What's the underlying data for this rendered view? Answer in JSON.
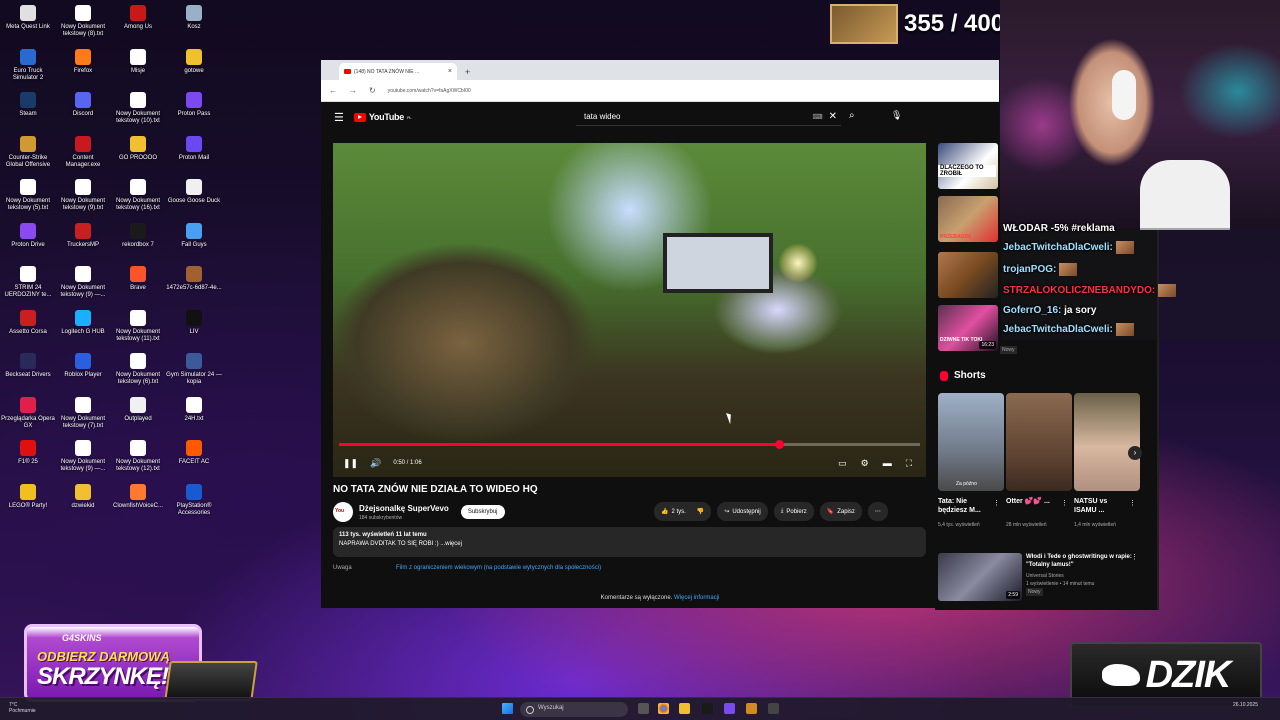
{
  "desktop_icons": [
    {
      "label": "Meta Quest Link",
      "color": "#e0e0e0"
    },
    {
      "label": "Nowy Dokument tekstowy (8).txt",
      "color": "#ffffff"
    },
    {
      "label": "Among Us",
      "color": "#c81818"
    },
    {
      "label": "Kosz",
      "color": "#9ab0c8"
    },
    {
      "label": "Euro Truck Simulator 2",
      "color": "#2a6ad0"
    },
    {
      "label": "Firefox",
      "color": "#ff7a18"
    },
    {
      "label": "Misje",
      "color": "#ffffff"
    },
    {
      "label": "gotowe",
      "color": "#f0c030"
    },
    {
      "label": "Steam",
      "color": "#1a3a6a"
    },
    {
      "label": "Discord",
      "color": "#5865f2"
    },
    {
      "label": "Nowy Dokument tekstowy (10).txt",
      "color": "#ffffff"
    },
    {
      "label": "Proton Pass",
      "color": "#7a4af0"
    },
    {
      "label": "Counter-Strike Global Offensive",
      "color": "#d09a30"
    },
    {
      "label": "Content Manager.exe",
      "color": "#c81820"
    },
    {
      "label": "GO PROOOO",
      "color": "#f0c030"
    },
    {
      "label": "Proton Mail",
      "color": "#6a4af0"
    },
    {
      "label": "Nowy Dokument tekstowy (5).txt",
      "color": "#ffffff"
    },
    {
      "label": "Nowy Dokument tekstowy (9).txt",
      "color": "#ffffff"
    },
    {
      "label": "Nowy Dokument tekstowy (16).txt",
      "color": "#ffffff"
    },
    {
      "label": "Goose Goose Duck",
      "color": "#f0f0f0"
    },
    {
      "label": "Proton Drive",
      "color": "#8a4af0"
    },
    {
      "label": "TruckersMP",
      "color": "#c82020"
    },
    {
      "label": "rekordbox 7",
      "color": "#1a1a1a"
    },
    {
      "label": "Fall Guys",
      "color": "#4aa0f0"
    },
    {
      "label": "STRIM 24 UERDOZINY te...",
      "color": "#ffffff"
    },
    {
      "label": "Nowy Dokument tekstowy (9) —...",
      "color": "#ffffff"
    },
    {
      "label": "Brave",
      "color": "#fb542b"
    },
    {
      "label": "1472e57c-6d87-4e...",
      "color": "#a06030"
    },
    {
      "label": "Assetto Corsa",
      "color": "#c82020"
    },
    {
      "label": "Logitech G HUB",
      "color": "#1ab0ff"
    },
    {
      "label": "Nowy Dokument tekstowy (11).txt",
      "color": "#ffffff"
    },
    {
      "label": "LIV",
      "color": "#111111"
    },
    {
      "label": "Beckseat Drivers",
      "color": "#2a2a5a"
    },
    {
      "label": "Roblox Player",
      "color": "#2a60e0"
    },
    {
      "label": "Nowy Dokument tekstowy (6).txt",
      "color": "#ffffff"
    },
    {
      "label": "Gym Simulator 24 — kopia",
      "color": "#3a5a9a"
    },
    {
      "label": "Przeglądarka Opera GX",
      "color": "#e0204a"
    },
    {
      "label": "Nowy Dokument tekstowy (7).txt",
      "color": "#ffffff"
    },
    {
      "label": "Outplayed",
      "color": "#f0f0f0"
    },
    {
      "label": "24H.txt",
      "color": "#ffffff"
    },
    {
      "label": "F1® 25",
      "color": "#e01010"
    },
    {
      "label": "Nowy Dokument tekstowy (9) —...",
      "color": "#ffffff"
    },
    {
      "label": "Nowy Dokument tekstowy (12).txt",
      "color": "#ffffff"
    },
    {
      "label": "FACEIT AC",
      "color": "#ff5a00"
    },
    {
      "label": "LEGO® Party!",
      "color": "#f0c020"
    },
    {
      "label": "dzwiekid",
      "color": "#f0c030"
    },
    {
      "label": "ClownfishVoiceC...",
      "color": "#ff7a30"
    },
    {
      "label": "PlayStation® Accessories",
      "color": "#1a5ad0"
    }
  ],
  "counter": {
    "value": "355 / 400"
  },
  "browser": {
    "tab_title": "(148) NO TATA ZNÓW NIE ...",
    "tab_close": "×",
    "new_tab": "+",
    "back": "←",
    "forward": "→",
    "reload": "↻",
    "url": "youtube.com/watch?v=faAgXWCbI00"
  },
  "youtube": {
    "logo_text": "YouTube",
    "logo_sup": "PL",
    "search_query": "tata wideo",
    "player": {
      "time": "0:50 / 1:06",
      "progress": 0.757
    },
    "video_title": "NO TATA ZNÓW NIE DZIAŁA TO WIDEO HQ",
    "channel": {
      "name": "Dżejsonalkę SuperVevo",
      "subs": "184 subskrybentów",
      "subscribe": "Subskrybuj"
    },
    "actions": {
      "likes": "2 tys.",
      "share": "Udostępnij",
      "download": "Pobierz",
      "save": "Zapisz"
    },
    "description": {
      "meta": "113 tys. wyświetleń  11 lat temu",
      "text": "NAPRAWA DVDITAK TO SIĘ ROBI :) ...więcej"
    },
    "warning_label": "Uwaga",
    "warning_link": "Film z ograniczeniem wiekowym (na podstawie wytycznych dla społeczności)",
    "comments_off": "Komentarze są wyłączone.",
    "comments_link": "Więcej informacji"
  },
  "sidebar": {
    "thumb1_caption": "DLACZEGO TO ZROBIŁ",
    "thumb2_caption": "PRZEBADZIŁ",
    "thumb4_caption": "DZIWNE TIK TOKI",
    "thumb4_duration": "16:23",
    "nowy_badge": "Nowy",
    "shorts_heading": "Shorts",
    "shorts": [
      {
        "title": "Tata: Nie będziesz M...",
        "views": "5,4 tys. wyświetleń",
        "caption": "Za późno"
      },
      {
        "title": "Otter 💕💕 ...",
        "views": "28 mln wyświetleń"
      },
      {
        "title": "NATSU vs ISAMU ...",
        "views": "1,4 mln wyświetleń"
      }
    ],
    "rec": {
      "title": "Włodi i Tede o ghostwritingu w rapie: \"Totalny lamus!\"",
      "channel": "Universal Stories",
      "meta": "1 wyświetlenie • 14 minut temu",
      "badge": "Nowy",
      "duration": "2:59"
    }
  },
  "chat": {
    "lines": [
      {
        "user": "WŁODAR",
        "text": "-5% #reklama"
      },
      {
        "user": "JebacTwitchaDlaCweli:",
        "text": ""
      },
      {
        "user": "trojanPOG:",
        "text": ""
      },
      {
        "user": "STRZALOKOLICZNEBANDYDO:",
        "text": ""
      },
      {
        "user": "GoferrO_16:",
        "text": "ja sory"
      },
      {
        "user": "JebacTwitchaDlaCweli:",
        "text": ""
      }
    ]
  },
  "promo": {
    "brand": "G4SKINS",
    "line1": "ODBIERZ DARMOWĄ",
    "line2": "SKRZYNKĘ!"
  },
  "dzik": {
    "text": "DZIK"
  },
  "taskbar": {
    "weather_temp": "7°C",
    "weather_desc": "Pochmurnie",
    "search_placeholder": "Wyszukaj",
    "date": "26.10.2025"
  }
}
